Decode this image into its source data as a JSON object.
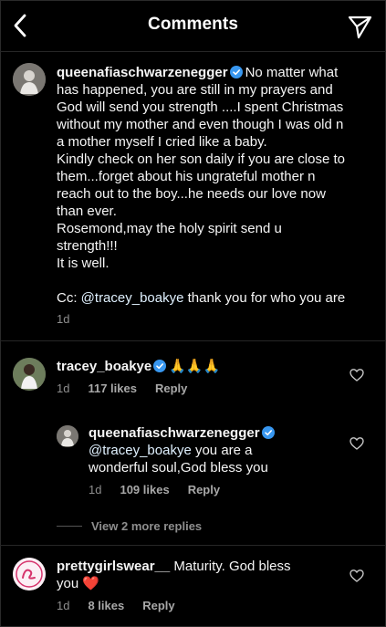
{
  "header": {
    "title": "Comments"
  },
  "caption": {
    "username": "queenafiaschwarzenegger",
    "lines": [
      "No matter what",
      "has happened, you are still in my prayers and",
      "God will send you strength ....I spent Christmas",
      "without my mother and even though I was old n",
      "a mother myself I cried like a baby.",
      "Kindly check on her son daily if you are close to",
      "them...forget about his ungrateful mother n",
      "reach out to the boy...he needs our love now",
      "than ever.",
      "Rosemond,may the holy spirit send u",
      "strength!!!",
      "It is well."
    ],
    "cc_prefix": "Cc: ",
    "cc_mention": "@tracey_boakye",
    "cc_suffix": " thank you for who you are",
    "time": "1d"
  },
  "comments": [
    {
      "username": "tracey_boakye",
      "text": "🙏🙏🙏",
      "time": "1d",
      "likes": "117 likes",
      "reply": "Reply"
    },
    {
      "username": "queenafiaschwarzenegger",
      "mention": "@tracey_boakye",
      "text_line1": " you are a",
      "text_line2": "wonderful soul,God bless you",
      "time": "1d",
      "likes": "109 likes",
      "reply": "Reply"
    },
    {
      "username": "prettygirlswear__",
      "text_line1": "Maturity. God bless",
      "text_line2": "you",
      "emoji": "❤️",
      "time": "1d",
      "likes": "8 likes",
      "reply": "Reply"
    }
  ],
  "view_replies": "View 2 more replies",
  "icons": {
    "back": "chevron-left-icon",
    "send": "paper-plane-icon",
    "verified": "verified-badge-icon",
    "like": "heart-outline-icon"
  },
  "colors": {
    "verified": "#3897f0",
    "background": "#000000",
    "meta": "#8e8e8e"
  }
}
